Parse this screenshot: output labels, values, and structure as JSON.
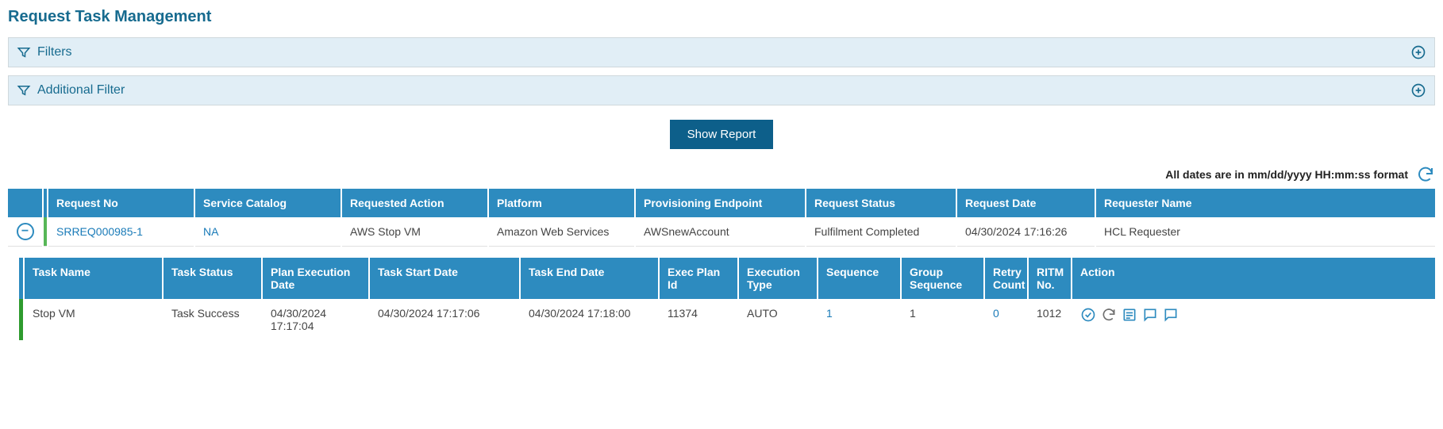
{
  "title": "Request Task Management",
  "filters": {
    "filters_label": "Filters",
    "additional_label": "Additional Filter"
  },
  "show_report_label": "Show Report",
  "date_note": "All dates are in mm/dd/yyyy HH:mm:ss format",
  "outer_table": {
    "headers": {
      "expand": "",
      "stripe": "",
      "request_no": "Request No",
      "service_catalog": "Service Catalog",
      "requested_action": "Requested Action",
      "platform": "Platform",
      "provisioning_endpoint": "Provisioning Endpoint",
      "request_status": "Request Status",
      "request_date": "Request Date",
      "requester_name": "Requester Name"
    },
    "rows": [
      {
        "request_no": "SRREQ000985-1",
        "service_catalog": "NA",
        "requested_action": "AWS Stop VM",
        "platform": "Amazon Web Services",
        "provisioning_endpoint": "AWSnewAccount",
        "request_status": "Fulfilment Completed",
        "request_date": "04/30/2024 17:16:26",
        "requester_name": "HCL Requester"
      }
    ]
  },
  "inner_table": {
    "headers": {
      "stripe": "",
      "task_name": "Task Name",
      "task_status": "Task Status",
      "plan_execution_date": "Plan Execution Date",
      "task_start_date": "Task Start Date",
      "task_end_date": "Task End Date",
      "exec_plan_id": "Exec Plan Id",
      "execution_type": "Execution Type",
      "sequence": "Sequence",
      "group_sequence": "Group Sequence",
      "retry_count": "Retry Count",
      "ritm_no": "RITM No.",
      "action": "Action"
    },
    "rows": [
      {
        "task_name": "Stop VM",
        "task_status": "Task Success",
        "plan_execution_date": "04/30/2024 17:17:04",
        "task_start_date": "04/30/2024 17:17:06",
        "task_end_date": "04/30/2024 17:18:00",
        "exec_plan_id": "11374",
        "execution_type": "AUTO",
        "sequence": "1",
        "group_sequence": "1",
        "retry_count": "0",
        "ritm_no": "1012"
      }
    ]
  }
}
